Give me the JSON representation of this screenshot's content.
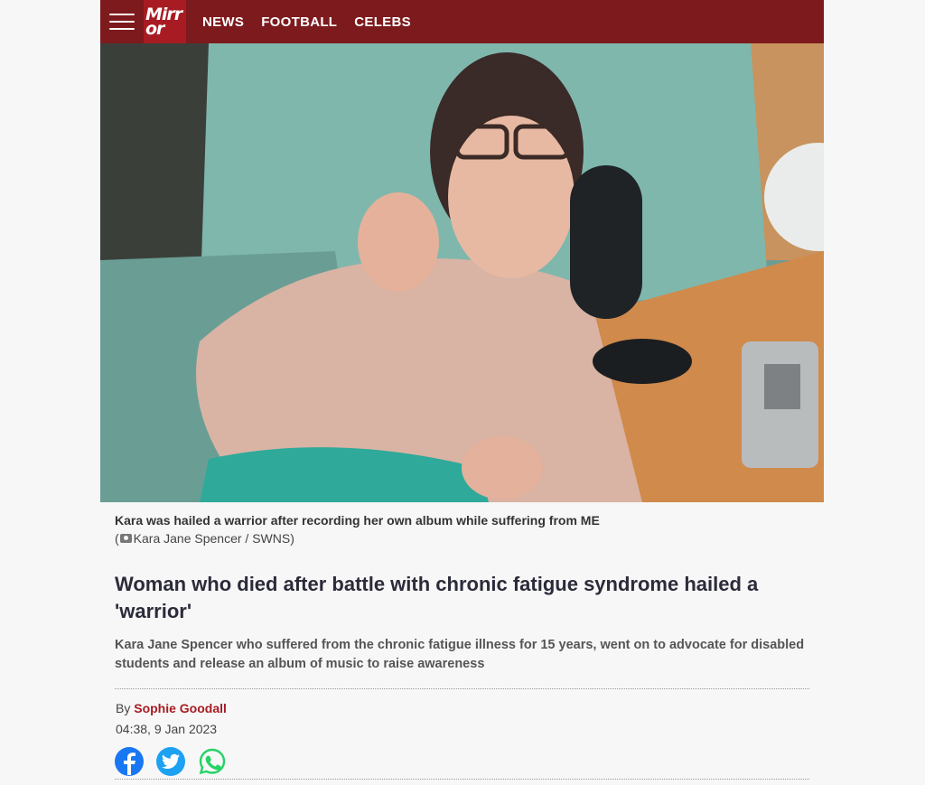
{
  "header": {
    "logo_line1": "Mirr",
    "logo_line2": "or",
    "nav": [
      "NEWS",
      "FOOTBALL",
      "CELEBS"
    ]
  },
  "article": {
    "caption": "Kara was hailed a warrior after recording her own album while suffering from ME",
    "credit_prefix": "(",
    "credit": "Kara Jane Spencer / SWNS)",
    "headline": "Woman who died after battle with chronic fatigue syndrome hailed a 'warrior'",
    "standfirst": "Kara Jane Spencer who suffered from the chronic fatigue illness for 15 years, went on to advocate for disabled students and release an album of music to raise awareness",
    "byline_prefix": "By",
    "author": "Sophie Goodall",
    "date": "04:38, 9 Jan 2023"
  },
  "share": {
    "icons": [
      "facebook-icon",
      "twitter-icon",
      "whatsapp-icon"
    ]
  },
  "colors": {
    "nav_bg": "#7d1a1d",
    "logo_bg": "#a81b22",
    "author": "#a81b22",
    "facebook": "#1877f2",
    "twitter": "#1da1f2",
    "whatsapp": "#25d366"
  }
}
